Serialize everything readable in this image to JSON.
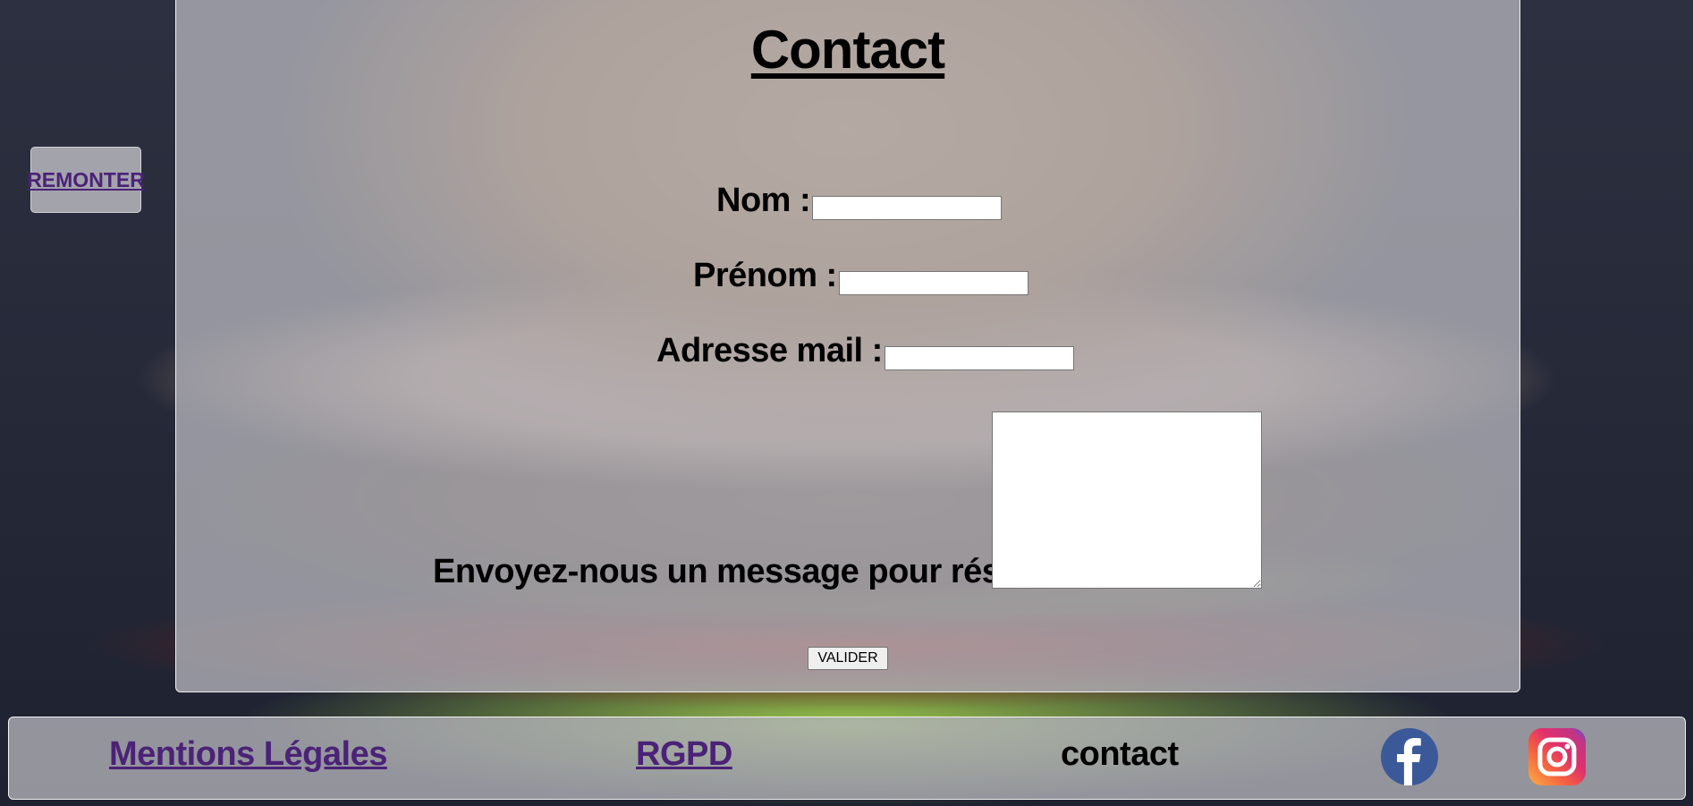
{
  "back_to_top": {
    "label": "REMONTER"
  },
  "contact": {
    "title": "Contact",
    "fields": {
      "nom": {
        "label": "Nom :",
        "value": ""
      },
      "prenom": {
        "label": "Prénom :",
        "value": ""
      },
      "email": {
        "label": "Adresse mail :",
        "value": ""
      }
    },
    "message": {
      "label": "Envoyez-nous un message pour réserver",
      "value": ""
    },
    "submit_label": "VALIDER"
  },
  "footer": {
    "legal_label": "Mentions Légales",
    "rgpd_label": "RGPD",
    "contact_label": "contact",
    "social": [
      "facebook-icon",
      "instagram-icon"
    ]
  },
  "colors": {
    "panel": "#b0b0b8",
    "visited_link": "#4b2277",
    "text": "#000000",
    "facebook": "#3b5998"
  }
}
